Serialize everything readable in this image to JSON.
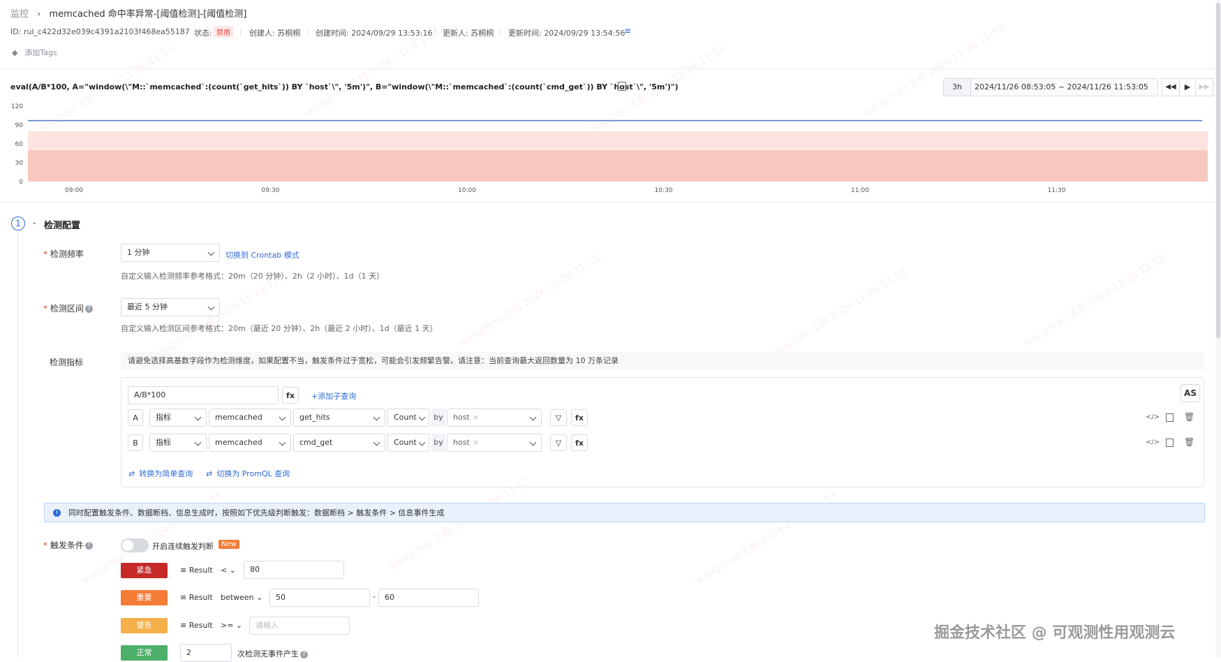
{
  "breadcrumb": {
    "root": "监控",
    "title": "memcached 命中率异常-[阈值检测]-[阈值检测]"
  },
  "meta": {
    "id": "ID: rul_c422d32e039c4391a2103f468ea55187",
    "status_label": "状态:",
    "status_value": "禁用",
    "creator": "创建人: 苏桐桐",
    "created_at": "创建时间: 2024/09/29 13:53:16",
    "updater": "更新人: 苏桐桐",
    "updated_at": "更新时间: 2024/09/29 13:54:56"
  },
  "tags": {
    "add_label": "添加Tags"
  },
  "query": {
    "expression": "eval(A/B*100, A=\"window(\\\"M::`memcached`:(count(`get_hits`)) BY `host`\\\", '5m')\", B=\"window(\\\"M::`memcached`:(count(`cmd_get`)) BY `host`\\\", '5m')\")"
  },
  "time_range": {
    "quick": "3h",
    "range": "2024/11/26 08:53:05 ~ 2024/11/26 11:53:05"
  },
  "chart_data": {
    "type": "line",
    "y_ticks": [
      "120",
      "90",
      "60",
      "30",
      "0"
    ],
    "ylim": [
      0,
      120
    ],
    "x_ticks": [
      "09:00",
      "09:30",
      "10:00",
      "10:30",
      "11:00",
      "11:30"
    ],
    "series": [
      {
        "values": [
          97,
          97,
          97,
          97,
          97,
          97
        ]
      }
    ],
    "bands": [
      {
        "from": 0,
        "to": 50,
        "color": "#f6c8c0"
      },
      {
        "from": 50,
        "to": 80,
        "color": "#fbe3e0"
      }
    ],
    "line_color": "#5b7ec9"
  },
  "section": {
    "number": "1",
    "title": "检测配置"
  },
  "frequency": {
    "label": "检测频率",
    "value": "1 分钟",
    "switch_link": "切换到 Crontab 模式",
    "hint": "自定义输入检测频率参考格式：20m（20 分钟）、2h（2 小时）、1d（1 天）"
  },
  "interval": {
    "label": "检测区间",
    "value": "最近 5 分钟",
    "hint": "自定义输入检测区间参考格式：20m（最近 20 分钟）、2h（最近 2 小时）、1d（最近 1 天）"
  },
  "metrics": {
    "label": "检测指标",
    "warning": "请避免选择高基数字段作为检测维度，如果配置不当，触发条件过于宽松，可能会引发频繁告警。请注意：当前查询最大返回数量为 10 万条记录",
    "formula": "A/B*100",
    "fx": "fx",
    "add_subquery": "+添加子查询",
    "as_label": "AS",
    "rows": [
      {
        "key": "A",
        "type": "指标",
        "measurement": "memcached",
        "field": "get_hits",
        "agg": "Count",
        "by": "by",
        "group": "host"
      },
      {
        "key": "B",
        "type": "指标",
        "measurement": "memcached",
        "field": "cmd_get",
        "agg": "Count",
        "by": "by",
        "group": "host"
      }
    ],
    "to_simple": "转换为简单查询",
    "to_promql": "切换为 PromQL 查询"
  },
  "info_banner": "同时配置触发条件、数据断档、信息生成时，按照如下优先级判断触发：数据断档 > 触发条件 > 信息事件生成",
  "trigger": {
    "label": "触发条件",
    "toggle_label": "开启连续触发判断",
    "new_badge": "New",
    "levels": [
      {
        "name": "紧急",
        "color": "#c62828",
        "metric": "Result",
        "op": "<",
        "v1": "80"
      },
      {
        "name": "重要",
        "color": "#f57c37",
        "metric": "Result",
        "op": "between",
        "v1": "50",
        "v2": "60",
        "dash": "-"
      },
      {
        "name": "警告",
        "color": "#f5b04a",
        "metric": "Result",
        "op": ">=",
        "placeholder": "请输入"
      },
      {
        "name": "正常",
        "color": "#4caf6a",
        "count": "2",
        "suffix": "次检测无事件产生"
      }
    ]
  },
  "footer_watermark": "掘金技术社区 @ 可观测性用观测云",
  "bg_watermark": "wangchao 王超 2024-11-26 11:53"
}
